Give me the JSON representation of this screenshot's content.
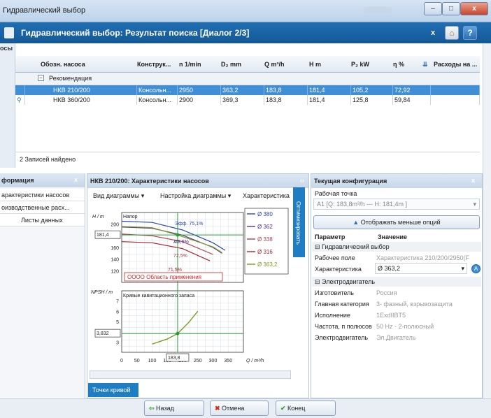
{
  "window": {
    "title": "Гидравлический выбор",
    "buttons": [
      "–",
      "□",
      "x"
    ]
  },
  "dialog": {
    "title": "Гидравлический выбор: Результат поиска [Диалог 2/3]",
    "buttons": [
      "x",
      "⌂",
      "?"
    ]
  },
  "results": {
    "label": "осы",
    "columns": [
      "Обозн. насоса",
      "Конструк...",
      "n 1/min",
      "D₂ mm",
      "Q m³/h",
      "H m",
      "P₂ kW",
      "η %",
      "Расходы на ..."
    ],
    "group": "Рекомендация",
    "rows": [
      {
        "name": "НКВ 210/200",
        "type": "Консольн...",
        "n": "2950",
        "d": "363,2",
        "q": "183,8",
        "h": "181,4",
        "p": "105,2",
        "eta": "72,92",
        "selected": true
      },
      {
        "name": "НКВ 360/200",
        "type": "Консольн...",
        "n": "2900",
        "d": "369,3",
        "q": "183,8",
        "h": "181,4",
        "p": "125,8",
        "eta": "59,84",
        "selected": false
      }
    ],
    "count": "2 Записей найдено"
  },
  "info": {
    "title": "формация",
    "items": [
      "арактеристики насосов",
      "оизводственные расх...",
      "Листы данных"
    ]
  },
  "chart_panel": {
    "title": "НКВ 210/200: Характеристики насосов",
    "menus": [
      "Вид диаграммы",
      "Настройка диаграммы",
      "Характеристика"
    ],
    "side_button": "Оптимизировать",
    "points_button": "Точки кривой"
  },
  "chart_data": [
    {
      "type": "line",
      "title": "Напор",
      "ylabel": "H / m",
      "xlim": [
        0,
        400
      ],
      "ylim": [
        100,
        220
      ],
      "yticks": [
        120,
        140,
        160,
        180,
        200
      ],
      "marker_y": "181,4",
      "legend": [
        "Ø 380",
        "Ø 362",
        "Ø 338",
        "Ø 316",
        "Ø 363,2"
      ],
      "efficiency_labels": [
        "Эфф. 75,1%",
        "73,6%",
        "72,5%",
        "71,5%"
      ],
      "operating_point_label": "A1",
      "annotation": "OOOO Область применения",
      "series": [
        {
          "name": "Ø 380",
          "color": "#2c49a8",
          "x": [
            0,
            100,
            200,
            300,
            340
          ],
          "y": [
            205,
            203,
            190,
            168,
            155
          ]
        },
        {
          "name": "Ø 362",
          "color": "#5a2f9b",
          "x": [
            0,
            100,
            200,
            300,
            330
          ],
          "y": [
            195,
            193,
            181,
            160,
            150
          ]
        },
        {
          "name": "Ø 338",
          "color": "#b04050",
          "x": [
            0,
            100,
            200,
            300
          ],
          "y": [
            183,
            180,
            170,
            148
          ]
        },
        {
          "name": "Ø 316",
          "color": "#b02030",
          "x": [
            0,
            100,
            200,
            290
          ],
          "y": [
            170,
            168,
            158,
            137
          ]
        },
        {
          "name": "Ø 363,2",
          "color": "#7d9a20",
          "x": [
            0,
            100,
            183.8,
            300,
            330
          ],
          "y": [
            196,
            194,
            181.4,
            161,
            151
          ]
        }
      ]
    },
    {
      "type": "line",
      "title": "Кривые кавитационного запаса",
      "ylabel": "NPSH / m",
      "xlabel": "Q / m³/h",
      "xlim": [
        0,
        400
      ],
      "ylim": [
        2,
        8
      ],
      "xticks": [
        0,
        50,
        100,
        150,
        200,
        250,
        300,
        350
      ],
      "yticks": [
        3,
        4,
        5,
        6,
        7
      ],
      "marker_x": "183,8",
      "marker_y": "3,832",
      "series": [
        {
          "name": "Ø 363,2",
          "color": "#7d9a20",
          "x": [
            100,
            150,
            183.8,
            220,
            250
          ],
          "y": [
            2.8,
            3.3,
            3.832,
            4.9,
            6.0
          ]
        }
      ]
    }
  ],
  "config": {
    "title": "Текущая конфигурация",
    "working_point_label": "Рабочая точка",
    "working_point": "A1 [Q: 183,8m³/h --- H: 181,4m ]",
    "less_options": "Отображать меньше опций",
    "col_param": "Параметр",
    "col_value": "Значение",
    "section1": "Гидравлический выбор",
    "field_label": "Рабочее поле",
    "field_value": "Характеристика 210/200/2950(F",
    "char_label": "Характеристика",
    "char_value": "Ø 363,2",
    "section2": "Электродвигатель",
    "rows": [
      {
        "k": "Изготовитель",
        "v": "Россия"
      },
      {
        "k": "Главная категория",
        "v": "3- фазный, взрывозащита"
      },
      {
        "k": "Исполнение",
        "v": "1ExdIIBT5"
      },
      {
        "k": "Частота, п полюсов",
        "v": "50 Hz - 2-полюсный"
      },
      {
        "k": "Электродвигатель",
        "v": "Эл.Двигатель"
      }
    ]
  },
  "footer": {
    "back": "Назад",
    "cancel": "Отмена",
    "finish": "Конец"
  }
}
